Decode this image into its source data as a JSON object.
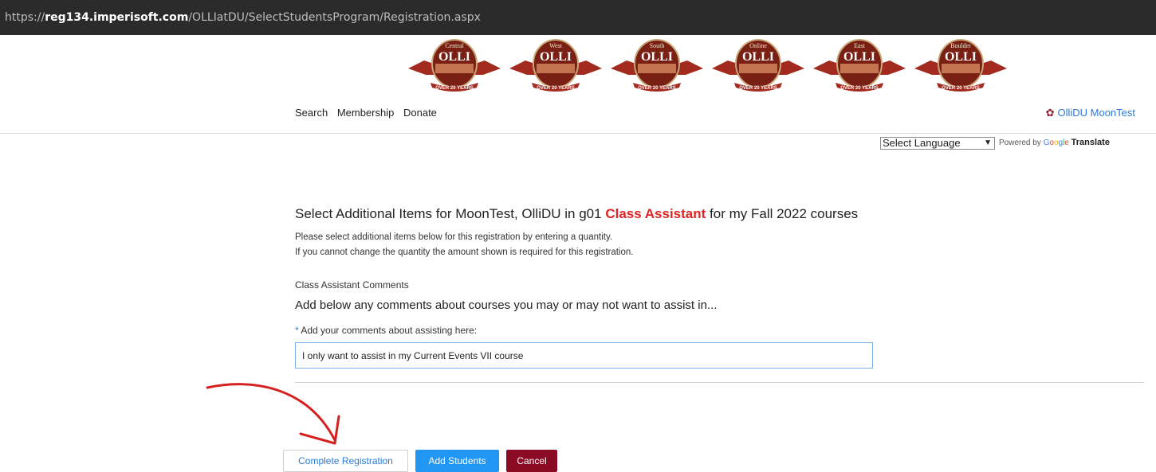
{
  "browser": {
    "url_scheme": "https://",
    "url_host": "reg134.imperisoft.com",
    "url_path": "/OLLIatDU/SelectStudentsProgram/Registration.aspx"
  },
  "header": {
    "logos": [
      {
        "campus": "Central",
        "name": "OLLI",
        "caption": "OVER 20 YEARS"
      },
      {
        "campus": "West",
        "name": "OLLI",
        "caption": "OVER 20 YEARS"
      },
      {
        "campus": "South",
        "name": "OLLI",
        "caption": "OVER 20 YEARS"
      },
      {
        "campus": "Online",
        "name": "OLLI",
        "caption": "OVER 20 YEARS"
      },
      {
        "campus": "East",
        "name": "OLLI",
        "caption": "OVER 20 YEARS"
      },
      {
        "campus": "Boulder",
        "name": "OLLI",
        "caption": "OVER 20 YEARS"
      }
    ],
    "nav": [
      "Search",
      "Membership",
      "Donate"
    ],
    "user_label": "OlliDU MoonTest",
    "language_select": "Select Language",
    "powered_by": "Powered by",
    "google": [
      "G",
      "o",
      "o",
      "g",
      "l",
      "e"
    ],
    "translate": "Translate"
  },
  "main": {
    "heading_prefix": "Select Additional Items for MoonTest, OlliDU in g01",
    "heading_accent": "Class Assistant",
    "heading_suffix": "for my Fall 2022 courses",
    "instruction_1": "Please select additional items below for this registration by entering a quantity.",
    "instruction_2": "If you cannot change the quantity the amount shown is required for this registration.",
    "section_title": "Class Assistant Comments",
    "section_subtitle": "Add below any comments about courses you may or may not want to assist in...",
    "field_required_mark": "*",
    "field_label": "Add your comments about assisting here:",
    "field_value": "I only want to assist in my Current Events VII course"
  },
  "actions": {
    "complete_label": "Complete Registration",
    "add_students_label": "Add Students",
    "cancel_label": "Cancel"
  },
  "colors": {
    "accent_red": "#e02424",
    "primary_blue": "#2196f3",
    "cancel_maroon": "#8b0a24",
    "logo_red": "#a32a1f",
    "annotation_arrow": "#d62020"
  }
}
